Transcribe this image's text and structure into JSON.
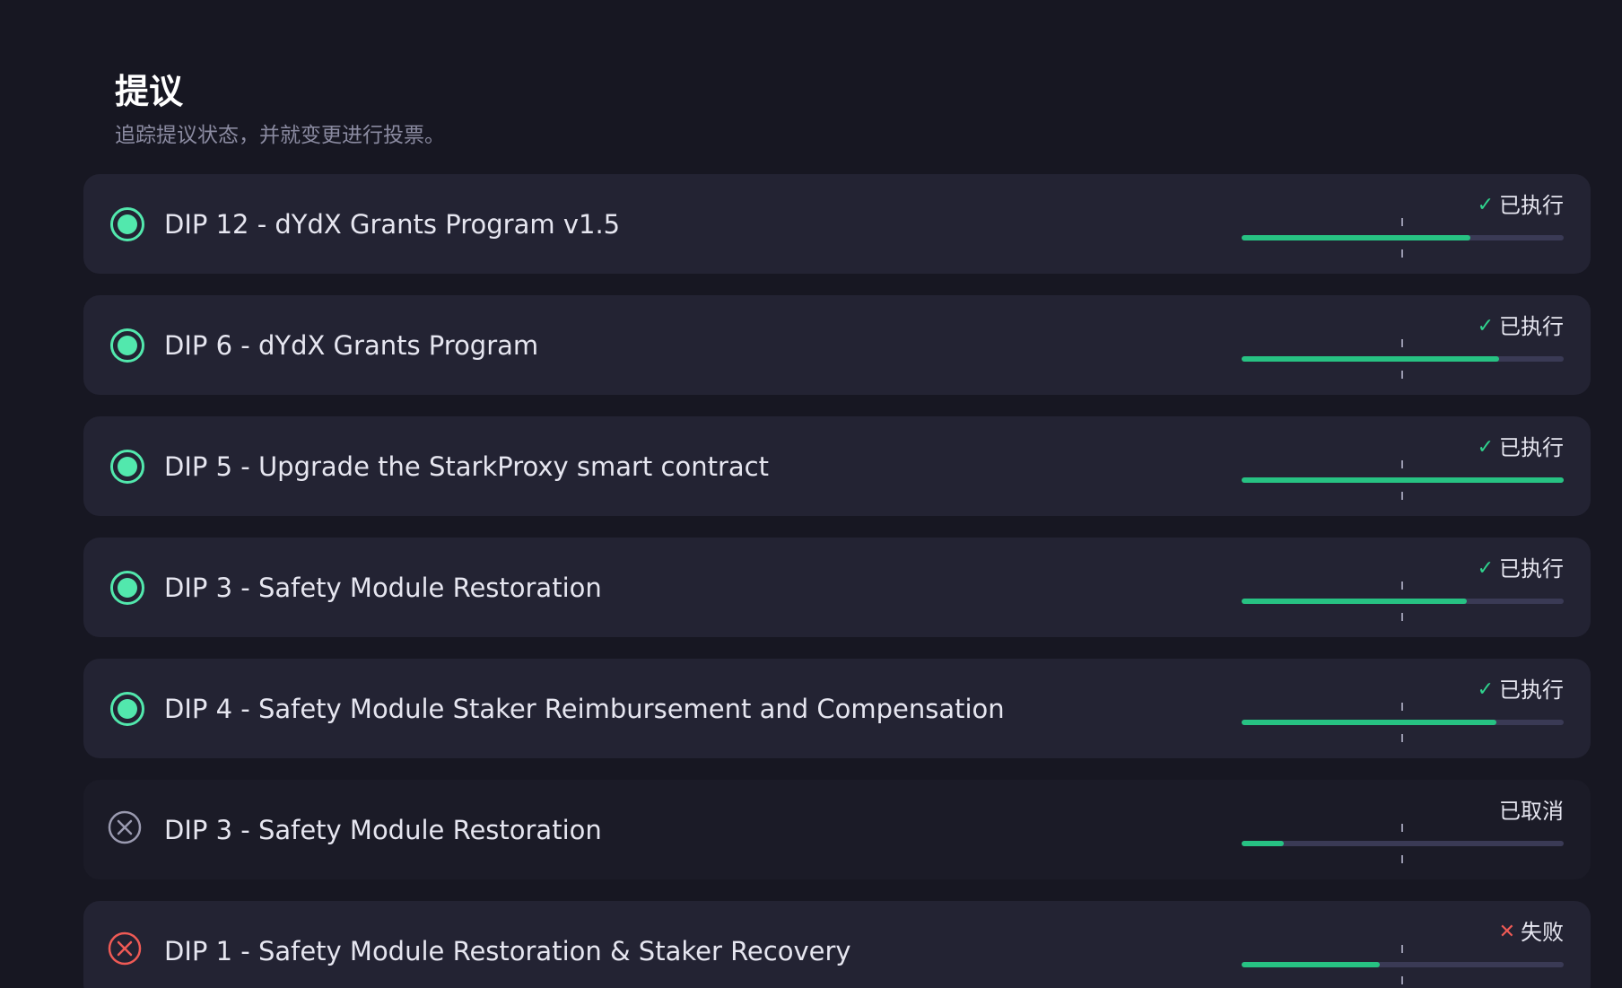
{
  "header": {
    "title": "提议",
    "subtitle": "追踪提议状态，并就变更进行投票。"
  },
  "proposals": [
    {
      "title": "DIP 12 - dYdX Grants Program v1.5",
      "status": "executed",
      "status_label": "已执行",
      "status_icon": "check-icon",
      "progress": 0.71
    },
    {
      "title": "DIP 6 - dYdX Grants Program",
      "status": "executed",
      "status_label": "已执行",
      "status_icon": "check-icon",
      "progress": 0.8
    },
    {
      "title": "DIP 5 - Upgrade the StarkProxy smart contract",
      "status": "executed",
      "status_label": "已执行",
      "status_icon": "check-icon",
      "progress": 1.0
    },
    {
      "title": "DIP 3 - Safety Module Restoration",
      "status": "executed",
      "status_label": "已执行",
      "status_icon": "check-icon",
      "progress": 0.7
    },
    {
      "title": "DIP 4 - Safety Module Staker Reimbursement and Compensation",
      "status": "executed",
      "status_label": "已执行",
      "status_icon": "check-icon",
      "progress": 0.79
    },
    {
      "title": "DIP 3 - Safety Module Restoration",
      "status": "canceled",
      "status_label": "已取消",
      "status_icon": "",
      "progress": 0.13
    },
    {
      "title": "DIP 1 - Safety Module Restoration & Staker Recovery",
      "status": "failed",
      "status_label": "失败",
      "status_icon": "close-icon",
      "progress": 0.43
    }
  ],
  "colors": {
    "background": "#171722",
    "card": "#232333",
    "accent_green": "#52e8ad",
    "progress_green": "#27c283",
    "fail_red": "#ef5a55",
    "muted": "#8a8aa0"
  }
}
